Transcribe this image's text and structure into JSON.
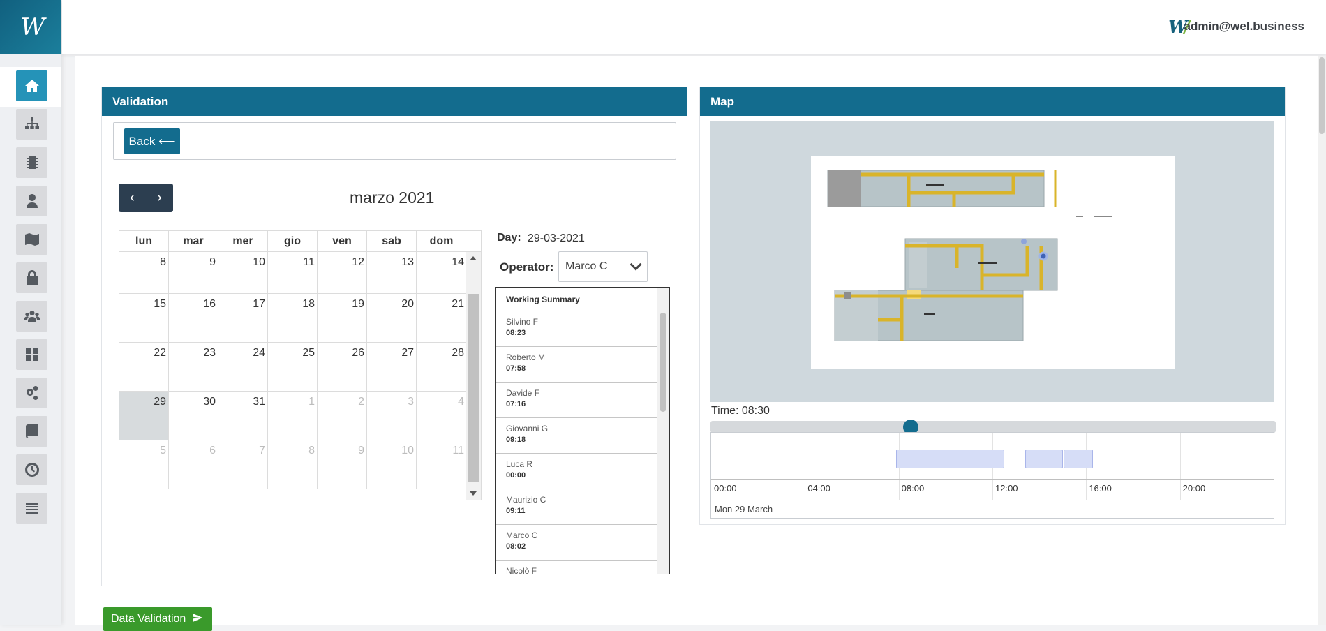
{
  "app": {
    "brand": "W"
  },
  "header": {
    "user_email": "admin@wel.business",
    "user_logo": "W"
  },
  "sidebar": {
    "items": [
      {
        "name": "home",
        "icon": "home-icon",
        "active": true
      },
      {
        "name": "sitemap",
        "icon": "sitemap-icon"
      },
      {
        "name": "devices",
        "icon": "chip-icon"
      },
      {
        "name": "operators",
        "icon": "user-tie-icon"
      },
      {
        "name": "maps",
        "icon": "map-icon"
      },
      {
        "name": "security",
        "icon": "lock-icon"
      },
      {
        "name": "users",
        "icon": "users-icon"
      },
      {
        "name": "dashboard",
        "icon": "grid-icon"
      },
      {
        "name": "settings",
        "icon": "cogs-icon"
      },
      {
        "name": "docs",
        "icon": "book-icon"
      },
      {
        "name": "history",
        "icon": "clock-icon"
      },
      {
        "name": "list",
        "icon": "list-icon"
      }
    ]
  },
  "validation": {
    "title": "Validation",
    "back_label": "Back ⟵",
    "calendar": {
      "title": "marzo 2021",
      "prev": "‹",
      "next": "›",
      "weekdays": [
        "lun",
        "mar",
        "mer",
        "gio",
        "ven",
        "sab",
        "dom"
      ],
      "weeks": [
        [
          {
            "d": "8"
          },
          {
            "d": "9"
          },
          {
            "d": "10"
          },
          {
            "d": "11"
          },
          {
            "d": "12"
          },
          {
            "d": "13"
          },
          {
            "d": "14"
          }
        ],
        [
          {
            "d": "15"
          },
          {
            "d": "16"
          },
          {
            "d": "17"
          },
          {
            "d": "18"
          },
          {
            "d": "19"
          },
          {
            "d": "20"
          },
          {
            "d": "21"
          }
        ],
        [
          {
            "d": "22"
          },
          {
            "d": "23"
          },
          {
            "d": "24"
          },
          {
            "d": "25"
          },
          {
            "d": "26"
          },
          {
            "d": "27"
          },
          {
            "d": "28"
          }
        ],
        [
          {
            "d": "29",
            "today": true
          },
          {
            "d": "30"
          },
          {
            "d": "31"
          },
          {
            "d": "1",
            "other": true
          },
          {
            "d": "2",
            "other": true
          },
          {
            "d": "3",
            "other": true
          },
          {
            "d": "4",
            "other": true
          }
        ],
        [
          {
            "d": "5",
            "other": true
          },
          {
            "d": "6",
            "other": true
          },
          {
            "d": "7",
            "other": true
          },
          {
            "d": "8",
            "other": true
          },
          {
            "d": "9",
            "other": true
          },
          {
            "d": "10",
            "other": true
          },
          {
            "d": "11",
            "other": true
          }
        ]
      ]
    },
    "day_label": "Day:",
    "day_value": "29-03-2021",
    "operator_label": "Operator:",
    "operator_selected": "Marco C",
    "summary_title": "Working Summary",
    "operators": [
      {
        "name": "Silvino F",
        "time": "08:23"
      },
      {
        "name": "Roberto M",
        "time": "07:58"
      },
      {
        "name": "Davide F",
        "time": "07:16"
      },
      {
        "name": "Giovanni G",
        "time": "09:18"
      },
      {
        "name": "Luca R",
        "time": "00:00"
      },
      {
        "name": "Maurizio C",
        "time": "09:11"
      },
      {
        "name": "Marco C",
        "time": "08:02"
      },
      {
        "name": "Nicolò F",
        "time": ""
      }
    ]
  },
  "map": {
    "title": "Map",
    "time_label": "Time: 08:30",
    "slider_value_hours": 8.5,
    "timeline": {
      "ticks": [
        "00:00",
        "04:00",
        "08:00",
        "12:00",
        "16:00",
        "20:00"
      ],
      "date_label": "Mon 29 March",
      "intervals": [
        {
          "start": 7.9,
          "end": 12.5
        },
        {
          "start": 13.4,
          "end": 15.0
        },
        {
          "start": 15.05,
          "end": 16.3
        }
      ]
    }
  },
  "footer": {
    "data_validation_label": "Data Validation"
  },
  "colors": {
    "primary": "#136c8e",
    "active_nav": "#2593b8",
    "success": "#3a9a2b",
    "route_yellow": "#d9b42a"
  }
}
